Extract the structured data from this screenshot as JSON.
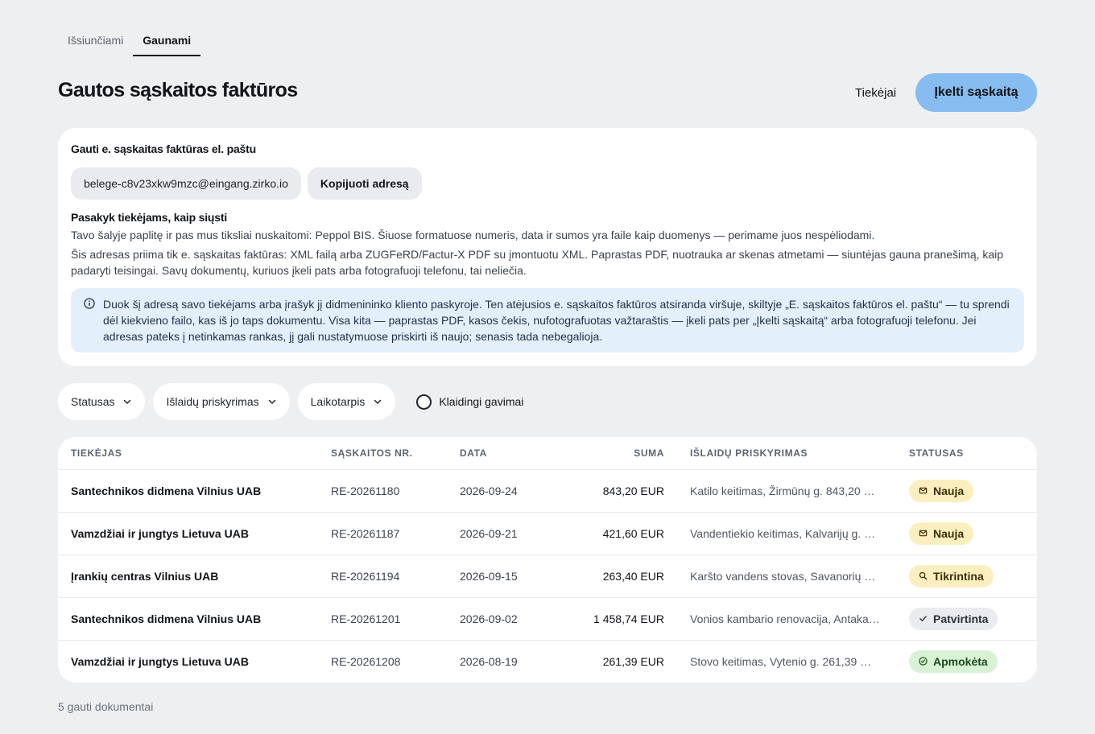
{
  "tabs": [
    {
      "label": "Išsiunčiami",
      "active": false
    },
    {
      "label": "Gaunami",
      "active": true
    }
  ],
  "header": {
    "title": "Gautos sąskaitos faktūros",
    "suppliers_label": "Tiekėjai",
    "upload_label": "Įkelti sąskaitą"
  },
  "email_card": {
    "title": "Gauti e. sąskaitas faktūras el. paštu",
    "address": "belege-c8v23xkw9mzc@eingang.zirko.io",
    "copy_label": "Kopijuoti adresą",
    "howto_title": "Pasakyk tiekėjams, kaip siųsti",
    "para1": "Tavo šalyje paplitę ir pas mus tiksliai nuskaitomi: Peppol BIS. Šiuose formatuose numeris, data ir sumos yra faile kaip duomenys — perimame juos nespėliodami.",
    "para2": "Šis adresas priima tik e. sąskaitas faktūras: XML failą arba ZUGFeRD/Factur-X PDF su įmontuotu XML. Paprastas PDF, nuotrauka ar skenas atmetami — siuntėjas gauna pranešimą, kaip padaryti teisingai. Savų dokumentų, kuriuos įkeli pats arba fotografuoji telefonu, tai neliečia.",
    "info": "Duok šį adresą savo tiekėjams arba įrašyk jį didmenininko kliento paskyroje. Ten atėjusios e. sąskaitos faktūros atsiranda viršuje, skiltyje „E. sąskaitos faktūros el. paštu“ — tu sprendi dėl kiekvieno failo, kas iš jo taps dokumentu. Visa kita — paprastas PDF, kasos čekis, nufotografuotas važtaraštis — įkeli pats per „Įkelti sąskaitą“ arba fotografuoji telefonu. Jei adresas pateks į netinkamas rankas, jį gali nustatymuose priskirti iš naujo; senasis tada nebegalioja."
  },
  "filters": {
    "status": "Statusas",
    "cost": "Išlaidų priskyrimas",
    "period": "Laikotarpis",
    "errors_label": "Klaidingi gavimai",
    "errors_checked": false
  },
  "table": {
    "headers": {
      "supplier": "Tiekėjas",
      "number": "Sąskaitos nr.",
      "date": "Data",
      "amount": "Suma",
      "cost": "Išlaidų priskyrimas",
      "status": "Statusas"
    },
    "rows": [
      {
        "supplier": "Santechnikos didmena Vilnius UAB",
        "number": "RE-20261180",
        "date": "2026-09-24",
        "amount": "843,20 EUR",
        "cost": "Katilo keitimas, Žirmūnų g. 843,20 …",
        "status": "Nauja",
        "status_icon": "mail-icon"
      },
      {
        "supplier": "Vamzdžiai ir jungtys Lietuva UAB",
        "number": "RE-20261187",
        "date": "2026-09-21",
        "amount": "421,60 EUR",
        "cost": "Vandentiekio keitimas, Kalvarijų g. …",
        "status": "Nauja",
        "status_icon": "mail-icon"
      },
      {
        "supplier": "Įrankių centras Vilnius UAB",
        "number": "RE-20261194",
        "date": "2026-09-15",
        "amount": "263,40 EUR",
        "cost": "Karšto vandens stovas, Savanorių …",
        "status": "Tikrintina",
        "status_icon": "search-icon"
      },
      {
        "supplier": "Santechnikos didmena Vilnius UAB",
        "number": "RE-20261201",
        "date": "2026-09-02",
        "amount": "1 458,74 EUR",
        "cost": "Vonios kambario renovacija, Antaka…",
        "status": "Patvirtinta",
        "status_icon": "check-icon"
      },
      {
        "supplier": "Vamzdžiai ir jungtys Lietuva UAB",
        "number": "RE-20261208",
        "date": "2026-08-19",
        "amount": "261,39 EUR",
        "cost": "Stovo keitimas, Vytenio g. 261,39 …",
        "status": "Apmokėta",
        "status_icon": "check-circle-icon"
      }
    ]
  },
  "footer": {
    "count": "5 gauti dokumentai"
  }
}
